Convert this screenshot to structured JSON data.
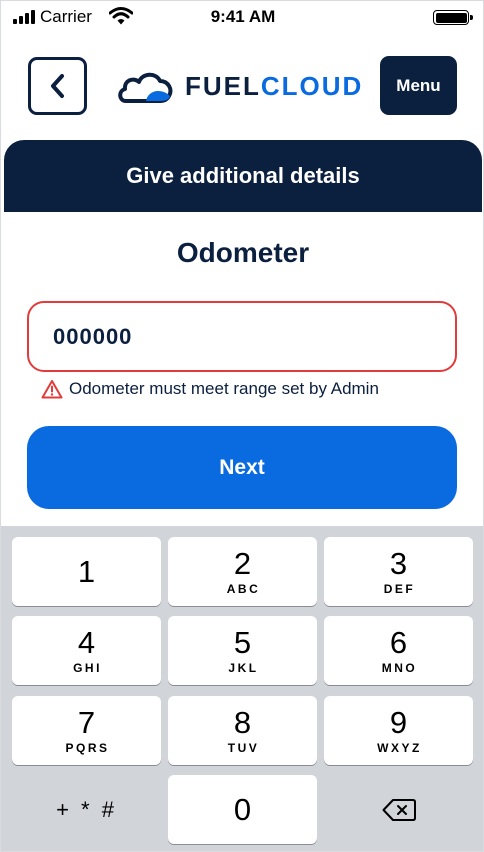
{
  "status_bar": {
    "carrier": "Carrier",
    "time": "9:41 AM"
  },
  "header": {
    "brand_part1": "FUEL",
    "brand_part2": "CLOUD",
    "menu_label": "Menu"
  },
  "banner": {
    "title": "Give additional details"
  },
  "form": {
    "field_label": "Odometer",
    "odometer_value": "000000",
    "error_message": "Odometer must meet range set by Admin",
    "next_label": "Next"
  },
  "keypad": {
    "keys": [
      {
        "digit": "1",
        "letters": ""
      },
      {
        "digit": "2",
        "letters": "ABC"
      },
      {
        "digit": "3",
        "letters": "DEF"
      },
      {
        "digit": "4",
        "letters": "GHI"
      },
      {
        "digit": "5",
        "letters": "JKL"
      },
      {
        "digit": "6",
        "letters": "MNO"
      },
      {
        "digit": "7",
        "letters": "PQRS"
      },
      {
        "digit": "8",
        "letters": "TUV"
      },
      {
        "digit": "9",
        "letters": "WXYZ"
      }
    ],
    "symbols": "+ * #",
    "zero": "0",
    "delete_icon": "backspace-icon"
  },
  "colors": {
    "navy": "#0b1f3f",
    "accent_blue": "#0a6be0",
    "error_red": "#e23b3b",
    "keypad_bg": "#d1d4d9"
  }
}
